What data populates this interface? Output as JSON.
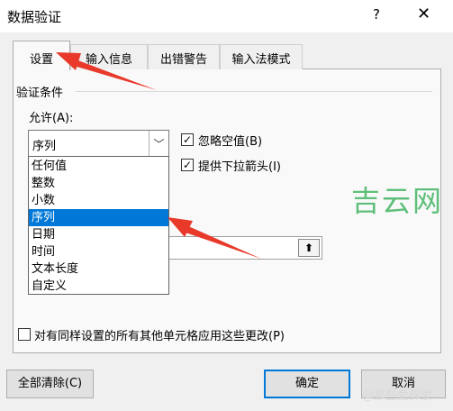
{
  "window": {
    "title": "数据验证",
    "help": "?",
    "close": "✕"
  },
  "tabs": [
    "设置",
    "输入信息",
    "出错警告",
    "输入法模式"
  ],
  "group": {
    "title": "验证条件"
  },
  "allow": {
    "label": "允许(A):",
    "selected": "序列"
  },
  "options": [
    "任何值",
    "整数",
    "小数",
    "序列",
    "日期",
    "时间",
    "文本长度",
    "自定义"
  ],
  "selected_index": 3,
  "ignore_blank": {
    "label": "忽略空值(B)",
    "checked": true
  },
  "dropdown_arrows": {
    "label": "提供下拉箭头(I)",
    "checked": true
  },
  "apply_all": {
    "label": "对有同样设置的所有其他单元格应用这些更改(P)",
    "checked": false
  },
  "buttons": {
    "clear": "全部清除(C)",
    "ok": "确定",
    "cancel": "取消"
  },
  "source_button": "⬆",
  "watermark": "吉云网",
  "bottom_watermark": "@那些爱探索",
  "colors": {
    "selection": "#0078d7",
    "arrow": "#e8392b",
    "watermark": "#5fbf7a"
  }
}
